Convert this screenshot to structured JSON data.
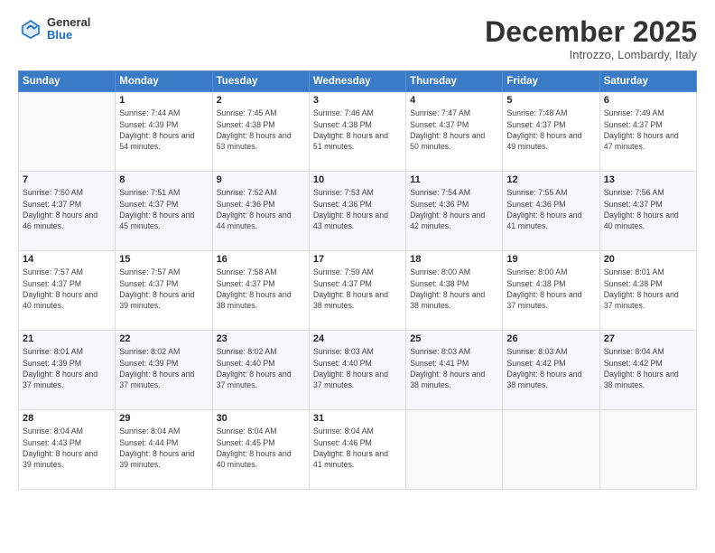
{
  "header": {
    "logo_general": "General",
    "logo_blue": "Blue",
    "month_title": "December 2025",
    "location": "Introzzo, Lombardy, Italy"
  },
  "weekdays": [
    "Sunday",
    "Monday",
    "Tuesday",
    "Wednesday",
    "Thursday",
    "Friday",
    "Saturday"
  ],
  "weeks": [
    [
      {
        "day": "",
        "sunrise": "",
        "sunset": "",
        "daylight": ""
      },
      {
        "day": "1",
        "sunrise": "Sunrise: 7:44 AM",
        "sunset": "Sunset: 4:39 PM",
        "daylight": "Daylight: 8 hours and 54 minutes."
      },
      {
        "day": "2",
        "sunrise": "Sunrise: 7:45 AM",
        "sunset": "Sunset: 4:38 PM",
        "daylight": "Daylight: 8 hours and 53 minutes."
      },
      {
        "day": "3",
        "sunrise": "Sunrise: 7:46 AM",
        "sunset": "Sunset: 4:38 PM",
        "daylight": "Daylight: 8 hours and 51 minutes."
      },
      {
        "day": "4",
        "sunrise": "Sunrise: 7:47 AM",
        "sunset": "Sunset: 4:37 PM",
        "daylight": "Daylight: 8 hours and 50 minutes."
      },
      {
        "day": "5",
        "sunrise": "Sunrise: 7:48 AM",
        "sunset": "Sunset: 4:37 PM",
        "daylight": "Daylight: 8 hours and 49 minutes."
      },
      {
        "day": "6",
        "sunrise": "Sunrise: 7:49 AM",
        "sunset": "Sunset: 4:37 PM",
        "daylight": "Daylight: 8 hours and 47 minutes."
      }
    ],
    [
      {
        "day": "7",
        "sunrise": "Sunrise: 7:50 AM",
        "sunset": "Sunset: 4:37 PM",
        "daylight": "Daylight: 8 hours and 46 minutes."
      },
      {
        "day": "8",
        "sunrise": "Sunrise: 7:51 AM",
        "sunset": "Sunset: 4:37 PM",
        "daylight": "Daylight: 8 hours and 45 minutes."
      },
      {
        "day": "9",
        "sunrise": "Sunrise: 7:52 AM",
        "sunset": "Sunset: 4:36 PM",
        "daylight": "Daylight: 8 hours and 44 minutes."
      },
      {
        "day": "10",
        "sunrise": "Sunrise: 7:53 AM",
        "sunset": "Sunset: 4:36 PM",
        "daylight": "Daylight: 8 hours and 43 minutes."
      },
      {
        "day": "11",
        "sunrise": "Sunrise: 7:54 AM",
        "sunset": "Sunset: 4:36 PM",
        "daylight": "Daylight: 8 hours and 42 minutes."
      },
      {
        "day": "12",
        "sunrise": "Sunrise: 7:55 AM",
        "sunset": "Sunset: 4:36 PM",
        "daylight": "Daylight: 8 hours and 41 minutes."
      },
      {
        "day": "13",
        "sunrise": "Sunrise: 7:56 AM",
        "sunset": "Sunset: 4:37 PM",
        "daylight": "Daylight: 8 hours and 40 minutes."
      }
    ],
    [
      {
        "day": "14",
        "sunrise": "Sunrise: 7:57 AM",
        "sunset": "Sunset: 4:37 PM",
        "daylight": "Daylight: 8 hours and 40 minutes."
      },
      {
        "day": "15",
        "sunrise": "Sunrise: 7:57 AM",
        "sunset": "Sunset: 4:37 PM",
        "daylight": "Daylight: 8 hours and 39 minutes."
      },
      {
        "day": "16",
        "sunrise": "Sunrise: 7:58 AM",
        "sunset": "Sunset: 4:37 PM",
        "daylight": "Daylight: 8 hours and 38 minutes."
      },
      {
        "day": "17",
        "sunrise": "Sunrise: 7:59 AM",
        "sunset": "Sunset: 4:37 PM",
        "daylight": "Daylight: 8 hours and 38 minutes."
      },
      {
        "day": "18",
        "sunrise": "Sunrise: 8:00 AM",
        "sunset": "Sunset: 4:38 PM",
        "daylight": "Daylight: 8 hours and 38 minutes."
      },
      {
        "day": "19",
        "sunrise": "Sunrise: 8:00 AM",
        "sunset": "Sunset: 4:38 PM",
        "daylight": "Daylight: 8 hours and 37 minutes."
      },
      {
        "day": "20",
        "sunrise": "Sunrise: 8:01 AM",
        "sunset": "Sunset: 4:38 PM",
        "daylight": "Daylight: 8 hours and 37 minutes."
      }
    ],
    [
      {
        "day": "21",
        "sunrise": "Sunrise: 8:01 AM",
        "sunset": "Sunset: 4:39 PM",
        "daylight": "Daylight: 8 hours and 37 minutes."
      },
      {
        "day": "22",
        "sunrise": "Sunrise: 8:02 AM",
        "sunset": "Sunset: 4:39 PM",
        "daylight": "Daylight: 8 hours and 37 minutes."
      },
      {
        "day": "23",
        "sunrise": "Sunrise: 8:02 AM",
        "sunset": "Sunset: 4:40 PM",
        "daylight": "Daylight: 8 hours and 37 minutes."
      },
      {
        "day": "24",
        "sunrise": "Sunrise: 8:03 AM",
        "sunset": "Sunset: 4:40 PM",
        "daylight": "Daylight: 8 hours and 37 minutes."
      },
      {
        "day": "25",
        "sunrise": "Sunrise: 8:03 AM",
        "sunset": "Sunset: 4:41 PM",
        "daylight": "Daylight: 8 hours and 38 minutes."
      },
      {
        "day": "26",
        "sunrise": "Sunrise: 8:03 AM",
        "sunset": "Sunset: 4:42 PM",
        "daylight": "Daylight: 8 hours and 38 minutes."
      },
      {
        "day": "27",
        "sunrise": "Sunrise: 8:04 AM",
        "sunset": "Sunset: 4:42 PM",
        "daylight": "Daylight: 8 hours and 38 minutes."
      }
    ],
    [
      {
        "day": "28",
        "sunrise": "Sunrise: 8:04 AM",
        "sunset": "Sunset: 4:43 PM",
        "daylight": "Daylight: 8 hours and 39 minutes."
      },
      {
        "day": "29",
        "sunrise": "Sunrise: 8:04 AM",
        "sunset": "Sunset: 4:44 PM",
        "daylight": "Daylight: 8 hours and 39 minutes."
      },
      {
        "day": "30",
        "sunrise": "Sunrise: 8:04 AM",
        "sunset": "Sunset: 4:45 PM",
        "daylight": "Daylight: 8 hours and 40 minutes."
      },
      {
        "day": "31",
        "sunrise": "Sunrise: 8:04 AM",
        "sunset": "Sunset: 4:46 PM",
        "daylight": "Daylight: 8 hours and 41 minutes."
      },
      {
        "day": "",
        "sunrise": "",
        "sunset": "",
        "daylight": ""
      },
      {
        "day": "",
        "sunrise": "",
        "sunset": "",
        "daylight": ""
      },
      {
        "day": "",
        "sunrise": "",
        "sunset": "",
        "daylight": ""
      }
    ]
  ]
}
